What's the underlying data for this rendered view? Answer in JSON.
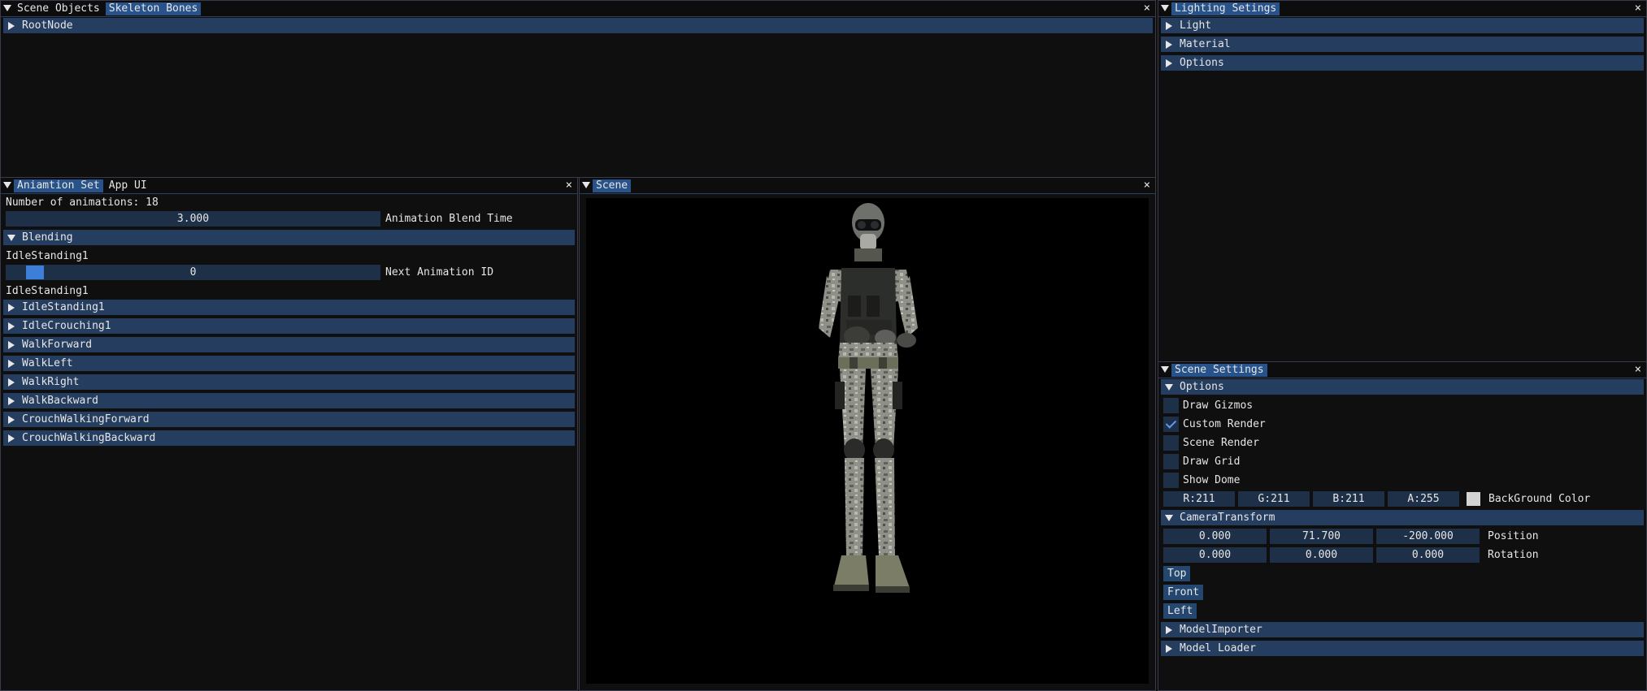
{
  "scene_objects_window": {
    "tabs": [
      "Scene Objects",
      "Skeleton Bones"
    ],
    "close": "×",
    "tree": [
      {
        "label": "RootNode"
      }
    ]
  },
  "lighting_window": {
    "title": "Lighting Setings",
    "close": "×",
    "sections": [
      {
        "label": "Light"
      },
      {
        "label": "Material"
      },
      {
        "label": "Options"
      }
    ]
  },
  "animation_window": {
    "tabs": [
      "Aniamtion Set",
      "App UI"
    ],
    "close": "×",
    "count_text": "Number of animations: 18",
    "blend_time_value": "3.000",
    "blend_time_label": "Animation Blend Time",
    "blending_header": "Blending",
    "current_animation": "IdleStanding1",
    "next_id_value": "0",
    "next_id_label": "Next Animation ID",
    "selected_animation": "IdleStanding1",
    "animations": [
      {
        "label": "IdleStanding1"
      },
      {
        "label": "IdleCrouching1"
      },
      {
        "label": "WalkForward"
      },
      {
        "label": "WalkLeft"
      },
      {
        "label": "WalkRight"
      },
      {
        "label": "WalkBackward"
      },
      {
        "label": "CrouchWalkingForward"
      },
      {
        "label": "CrouchWalkingBackward"
      }
    ]
  },
  "scene_window": {
    "title": "Scene",
    "close": "×"
  },
  "scene_settings_window": {
    "title": "Scene Settings",
    "close": "×",
    "options_header": "Options",
    "checkboxes": [
      {
        "label": "Draw Gizmos",
        "checked": false
      },
      {
        "label": "Custom Render",
        "checked": true
      },
      {
        "label": "Scene Render",
        "checked": false
      },
      {
        "label": "Draw Grid",
        "checked": false
      },
      {
        "label": "Show Dome",
        "checked": false
      }
    ],
    "background_color": {
      "r": "R:211",
      "g": "G:211",
      "b": "B:211",
      "a": "A:255",
      "label": "BackGround Color",
      "swatch": "#d3d3d3"
    },
    "camera_header": "CameraTransform",
    "position": {
      "x": "0.000",
      "y": "71.700",
      "z": "-200.000",
      "label": "Position"
    },
    "rotation": {
      "x": "0.000",
      "y": "0.000",
      "z": "0.000",
      "label": "Rotation"
    },
    "buttons": [
      {
        "label": "Top"
      },
      {
        "label": "Front"
      },
      {
        "label": "Left"
      }
    ],
    "collapsed_sections": [
      {
        "label": "ModelImporter"
      },
      {
        "label": "Model Loader"
      }
    ]
  },
  "colors": {
    "window_bg": "#0f0f0f",
    "header_bg": "#253d5f",
    "active_tab": "#28528a",
    "frame_bg": "#1e2f48",
    "accent": "#3c7ed8"
  }
}
